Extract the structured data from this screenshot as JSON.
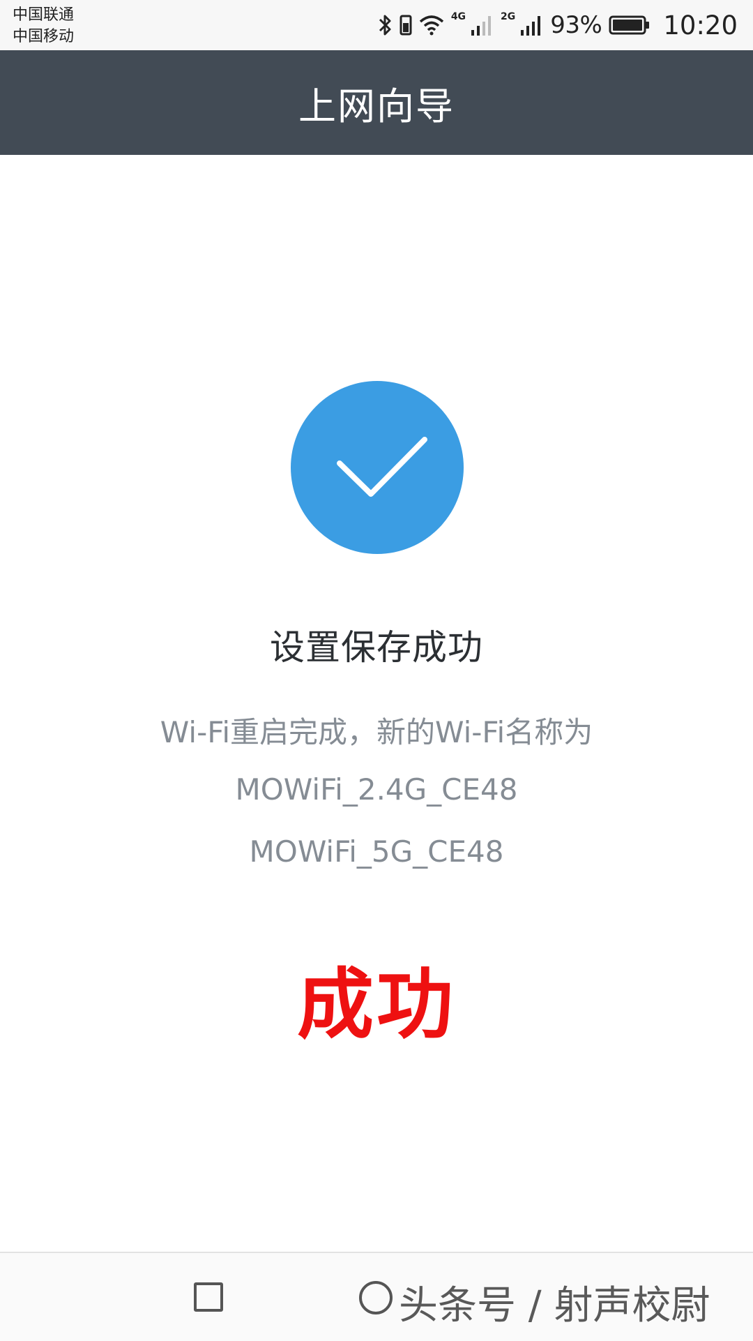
{
  "status_bar": {
    "carrier_1": "中国联通",
    "carrier_2": "中国移动",
    "network_1": "4G",
    "network_2": "2G",
    "battery_percent": "93%",
    "time": "10:20",
    "icons": [
      "bluetooth-icon",
      "vibrate-icon",
      "wifi-icon",
      "signal-icon",
      "signal-icon",
      "battery-icon"
    ]
  },
  "header": {
    "title": "上网向导"
  },
  "main": {
    "icon": "checkmark-icon",
    "accent_color": "#3b9de3",
    "heading": "设置保存成功",
    "message": "Wi-Fi重启完成，新的Wi-Fi名称为",
    "ssid_24g": "MOWiFi_2.4G_CE48",
    "ssid_5g": "MOWiFi_5G_CE48"
  },
  "overlay": {
    "text": "成功",
    "color": "#ee1111"
  },
  "nav_bar": {
    "recent_icon": "square-icon",
    "home_icon": "circle-icon",
    "watermark": "头条号 / 射声校尉"
  }
}
